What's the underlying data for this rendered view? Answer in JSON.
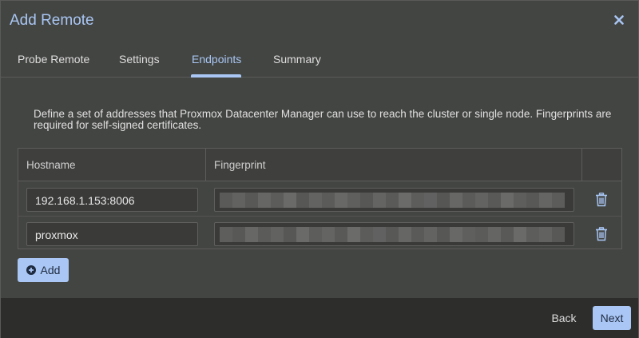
{
  "dialog": {
    "title": "Add Remote"
  },
  "tabs": [
    {
      "label": "Probe Remote"
    },
    {
      "label": "Settings"
    },
    {
      "label": "Endpoints",
      "active": true
    },
    {
      "label": "Summary"
    }
  ],
  "description": "Define a set of addresses that Proxmox Datacenter Manager can use to reach the cluster or single node. Fingerprints are required for self-signed certificates.",
  "grid": {
    "columns": [
      "Hostname",
      "Fingerprint"
    ],
    "rows": [
      {
        "hostname": "192.168.1.153:8006",
        "fingerprint_redacted": true
      },
      {
        "hostname": "proxmox",
        "fingerprint_redacted": true
      }
    ]
  },
  "buttons": {
    "add": "Add",
    "back": "Back",
    "next": "Next"
  },
  "colors": {
    "accent": "#a9c6f4",
    "background": "#434542",
    "footer": "#2d2e2c"
  },
  "icons": {
    "close": "close-icon",
    "delete": "trash-icon",
    "add": "plus-circle-icon"
  }
}
